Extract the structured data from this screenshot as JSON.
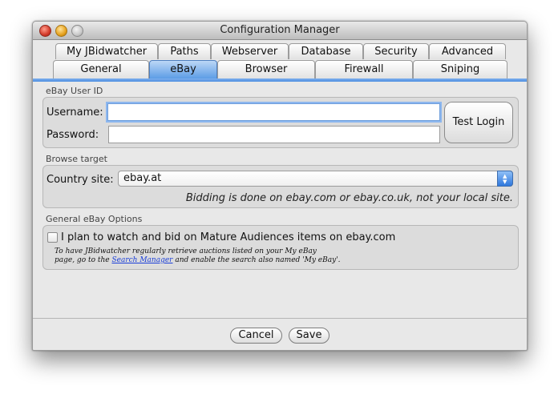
{
  "window": {
    "title": "Configuration Manager"
  },
  "tabs": {
    "row1": [
      {
        "label": "My JBidwatcher"
      },
      {
        "label": "Paths"
      },
      {
        "label": "Webserver"
      },
      {
        "label": "Database"
      },
      {
        "label": "Security"
      },
      {
        "label": "Advanced"
      }
    ],
    "row2": [
      {
        "label": "General"
      },
      {
        "label": "eBay",
        "active": true
      },
      {
        "label": "Browser"
      },
      {
        "label": "Firewall"
      },
      {
        "label": "Sniping"
      }
    ]
  },
  "ebay_user": {
    "section_label": "eBay User ID",
    "username_label": "Username:",
    "username_value": "",
    "password_label": "Password:",
    "password_value": "",
    "test_login_label": "Test Login"
  },
  "browse_target": {
    "section_label": "Browse target",
    "country_label": "Country site:",
    "country_value": "ebay.at",
    "note": "Bidding is done on ebay.com or ebay.co.uk, not your local site."
  },
  "general_options": {
    "section_label": "General eBay Options",
    "mature_label": "I plan to watch and bid on Mature Audiences items on ebay.com",
    "mature_checked": false,
    "help_line1": "To have JBidwatcher regularly retrieve auctions listed on your My eBay",
    "help_line2_prefix": "page, go to the ",
    "help_link": "Search Manager",
    "help_line2_suffix": " and enable the search also named 'My eBay'."
  },
  "footer": {
    "cancel_label": "Cancel",
    "save_label": "Save"
  },
  "colors": {
    "accent": "#5d9de6",
    "link": "#1a3ed8"
  }
}
